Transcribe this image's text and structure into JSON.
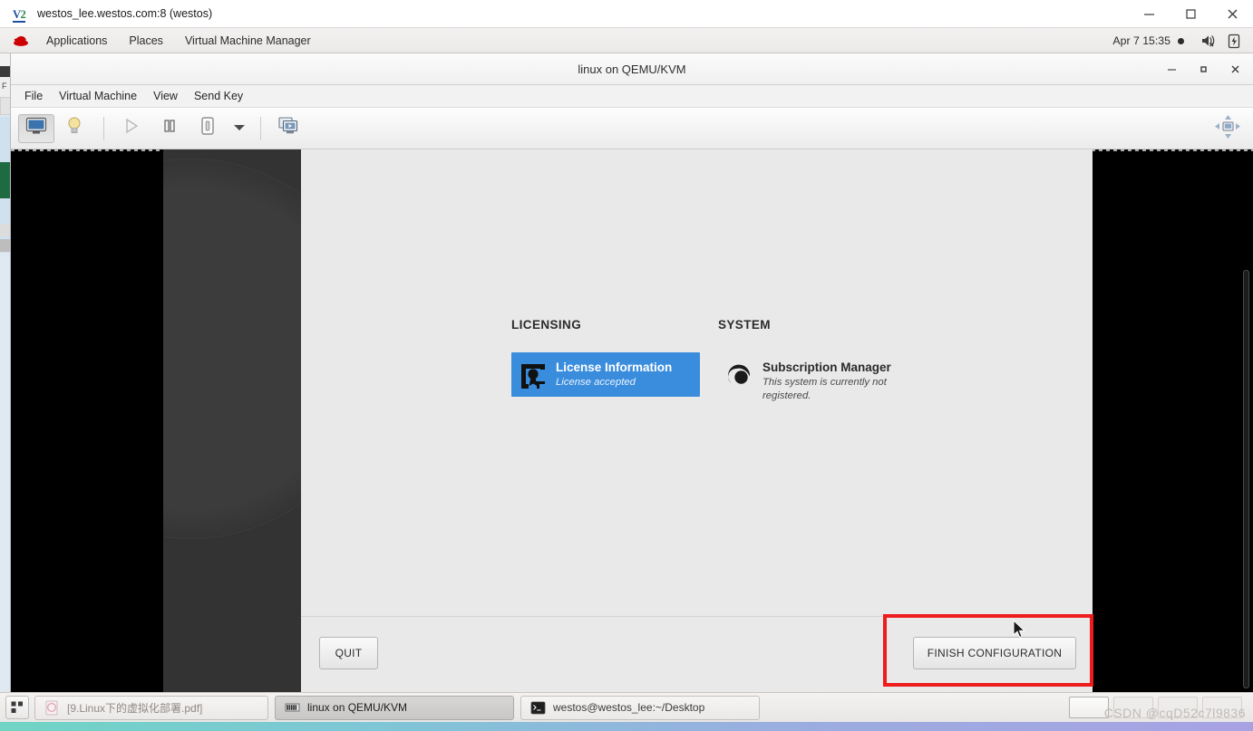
{
  "outer_window": {
    "title": "westos_lee.westos.com:8 (westos)",
    "icon": "vnc-viewer-icon",
    "buttons": [
      {
        "name": "minimize",
        "glyph": "minimize-icon"
      },
      {
        "name": "maximize",
        "glyph": "maximize-icon"
      },
      {
        "name": "close",
        "glyph": "close-icon"
      }
    ]
  },
  "gnome_panel": {
    "logo": "red-hat-icon",
    "items": [
      {
        "label": "Applications"
      },
      {
        "label": "Places"
      },
      {
        "label": "Virtual Machine Manager"
      }
    ],
    "clock": "Apr 7  15:35",
    "tray": [
      {
        "name": "volume-muted-icon"
      },
      {
        "name": "battery-icon"
      }
    ]
  },
  "vm_window": {
    "title": "linux on QEMU/KVM",
    "buttons": [
      {
        "name": "minimize",
        "glyph": "minimize-icon"
      },
      {
        "name": "maximize",
        "glyph": "maximize-icon"
      },
      {
        "name": "close",
        "glyph": "close-icon"
      }
    ],
    "menu": [
      {
        "label": "File"
      },
      {
        "label": "Virtual Machine"
      },
      {
        "label": "View"
      },
      {
        "label": "Send Key"
      }
    ],
    "toolbar": [
      {
        "name": "show-console-button",
        "icon": "monitor-icon",
        "state": "pressed"
      },
      {
        "name": "show-details-button",
        "icon": "lightbulb-icon",
        "state": "normal"
      },
      {
        "name": "run-button",
        "icon": "play-icon",
        "state": "disabled"
      },
      {
        "name": "pause-button",
        "icon": "pause-icon",
        "state": "normal"
      },
      {
        "name": "shutdown-button",
        "icon": "power-icon",
        "state": "normal"
      },
      {
        "name": "shutdown-menu-button",
        "icon": "chevron-down-icon",
        "state": "normal"
      },
      {
        "name": "snapshots-button",
        "icon": "snapshots-icon",
        "state": "normal"
      },
      {
        "name": "fullscreen-button",
        "icon": "fullscreen-icon",
        "state": "normal"
      }
    ]
  },
  "anaconda": {
    "sections": [
      {
        "title": "LICENSING",
        "items": [
          {
            "name": "License Information",
            "desc": "License accepted",
            "icon": "license-icon",
            "selected": true
          }
        ]
      },
      {
        "title": "SYSTEM",
        "items": [
          {
            "name": "Subscription Manager",
            "desc": "This system is currently not registered.",
            "icon": "subscription-icon",
            "selected": false
          }
        ]
      }
    ],
    "footer": {
      "quit_label": "QUIT",
      "finish_label": "FINISH CONFIGURATION"
    },
    "highlight_color": "#ee1c1c",
    "selected_color": "#3a8ddd"
  },
  "taskbar": {
    "show_desktop": "show-desktop-icon",
    "tasks": [
      {
        "label": "[9.Linux下的虚拟化部署.pdf]",
        "icon": "pdf-icon",
        "state": "inactive"
      },
      {
        "label": "linux on QEMU/KVM",
        "icon": "virt-manager-icon",
        "state": "active"
      },
      {
        "label": "westos@westos_lee:~/Desktop",
        "icon": "terminal-icon",
        "state": "normal"
      }
    ],
    "watermark": "CSDN @cqD52c7l9836"
  }
}
